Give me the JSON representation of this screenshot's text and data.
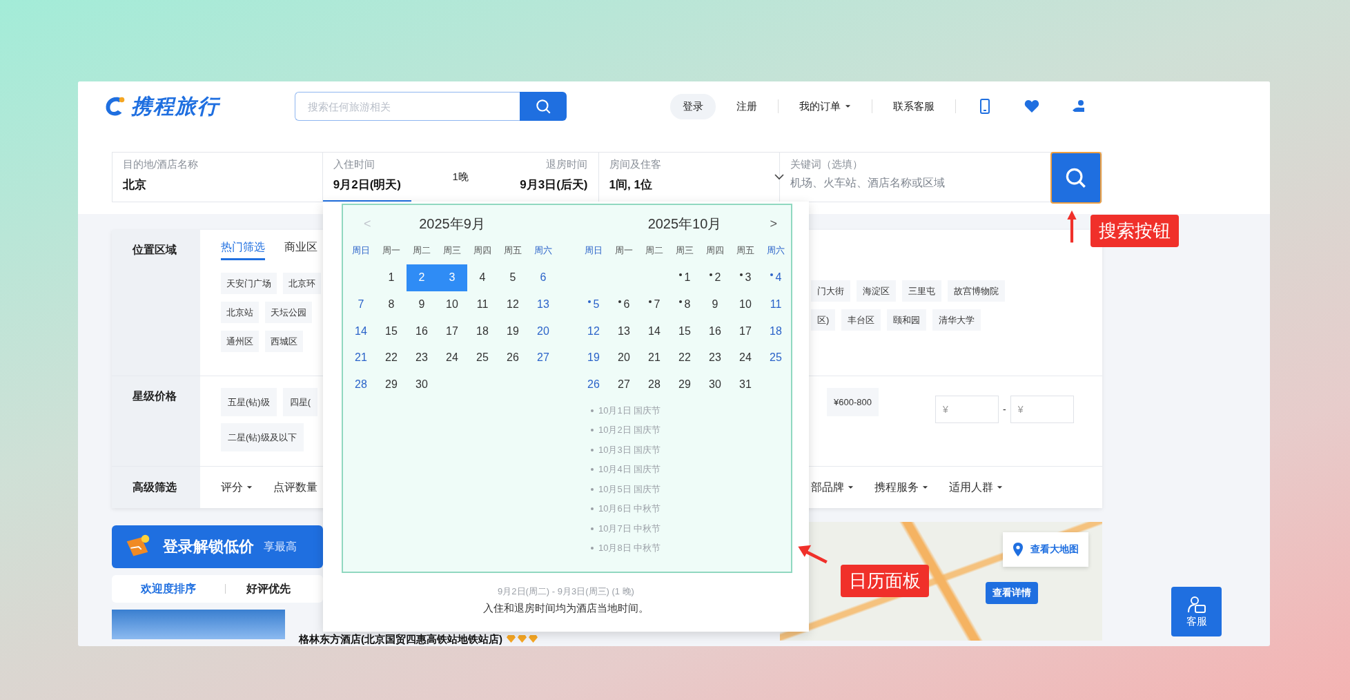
{
  "header": {
    "logo": "携程旅行",
    "search": {
      "placeholder": "搜索任何旅游相关"
    },
    "nav": [
      {
        "label": "登录",
        "kind": "pill"
      },
      {
        "label": "注册",
        "kind": "link"
      },
      {
        "label": "我的订单",
        "kind": "dropdown"
      },
      {
        "label": "联系客服",
        "kind": "link"
      }
    ]
  },
  "search_form": {
    "destination": {
      "label": "目的地/酒店名称",
      "value": "北京"
    },
    "checkin": {
      "label": "入住时间",
      "value": "9月2日(明天)",
      "selected": true
    },
    "nights": "1晚",
    "checkout": {
      "label": "退房时间",
      "value": "9月3日(后天)",
      "selected": false
    },
    "rooms": {
      "label": "房间及住客",
      "value": "1间, 1位"
    },
    "keyword": {
      "label": "关键词（选填）",
      "placeholder": "机场、火车站、酒店名称或区域"
    }
  },
  "filters": {
    "location": {
      "label": "位置区域",
      "tabs": [
        {
          "label": "热门筛选",
          "selected": true
        },
        {
          "label": "商业区",
          "selected": false
        }
      ],
      "tags_left": [
        [
          "天安门广场",
          "北京环"
        ],
        [
          "北京站",
          "天坛公园"
        ],
        [
          "通州区",
          "西城区"
        ]
      ],
      "tags_right": [
        [
          "门大街",
          "海淀区",
          "三里屯",
          "故宫博物院"
        ],
        [
          "区)",
          "丰台区",
          "颐和园",
          "清华大学"
        ]
      ]
    },
    "stars": {
      "label": "星级价格",
      "tags_left": [
        [
          "五星(钻)级",
          "四星("
        ],
        [
          "二星(钻)级及以下"
        ]
      ],
      "tags_right": [
        "¥600-800"
      ],
      "price_min": {
        "placeholder": "¥"
      },
      "range_separator": "-",
      "price_max": {
        "placeholder": "¥"
      }
    },
    "advanced": {
      "label": "高级筛选",
      "left": [
        {
          "label": "评分",
          "caret": true
        },
        {
          "label": "点评数量",
          "caret": false
        }
      ],
      "right": [
        {
          "label": "部品牌",
          "caret": true
        },
        {
          "label": "携程服务",
          "caret": true
        },
        {
          "label": "适用人群",
          "caret": true
        }
      ]
    }
  },
  "calendar": {
    "prev": {
      "label": "<",
      "disabled": true
    },
    "next": {
      "label": ">",
      "disabled": false
    },
    "months": [
      {
        "title": "2025年9月",
        "starts_midweek": true,
        "weekdays": [
          "周日",
          "周一",
          "周二",
          "周三",
          "周四",
          "周五",
          "周六"
        ],
        "weeks": [
          [
            {
              "d": "1",
              "selected": false,
              "holiday": false
            },
            {
              "d": "2",
              "selected": true,
              "holiday": false
            },
            {
              "d": "3",
              "selected": true,
              "holiday": false
            },
            {
              "d": "4",
              "selected": false,
              "holiday": false
            },
            {
              "d": "5",
              "selected": false,
              "holiday": false
            },
            {
              "d": "6",
              "selected": false,
              "holiday": false
            }
          ],
          [
            {
              "d": "7",
              "selected": false,
              "holiday": false
            },
            {
              "d": "8",
              "selected": false,
              "holiday": false
            },
            {
              "d": "9",
              "selected": false,
              "holiday": false
            },
            {
              "d": "10",
              "selected": false,
              "holiday": false
            },
            {
              "d": "11",
              "selected": false,
              "holiday": false
            },
            {
              "d": "12",
              "selected": false,
              "holiday": false
            },
            {
              "d": "13",
              "selected": false,
              "holiday": false
            }
          ],
          [
            {
              "d": "14",
              "selected": false,
              "holiday": false
            },
            {
              "d": "15",
              "selected": false,
              "holiday": false
            },
            {
              "d": "16",
              "selected": false,
              "holiday": false
            },
            {
              "d": "17",
              "selected": false,
              "holiday": false
            },
            {
              "d": "18",
              "selected": false,
              "holiday": false
            },
            {
              "d": "19",
              "selected": false,
              "holiday": false
            },
            {
              "d": "20",
              "selected": false,
              "holiday": false
            }
          ],
          [
            {
              "d": "21",
              "selected": false,
              "holiday": false
            },
            {
              "d": "22",
              "selected": false,
              "holiday": false
            },
            {
              "d": "23",
              "selected": false,
              "holiday": false
            },
            {
              "d": "24",
              "selected": false,
              "holiday": false
            },
            {
              "d": "25",
              "selected": false,
              "holiday": false
            },
            {
              "d": "26",
              "selected": false,
              "holiday": false
            },
            {
              "d": "27",
              "selected": false,
              "holiday": false
            }
          ],
          [
            {
              "d": "28",
              "selected": false,
              "holiday": false
            },
            {
              "d": "29",
              "selected": false,
              "holiday": false
            },
            {
              "d": "30",
              "selected": false,
              "holiday": false
            }
          ]
        ]
      },
      {
        "title": "2025年10月",
        "starts_midweek": true,
        "weekdays": [
          "周日",
          "周一",
          "周二",
          "周三",
          "周四",
          "周五",
          "周六"
        ],
        "weeks": [
          [
            {
              "d": "1",
              "selected": false,
              "holiday": true
            },
            {
              "d": "2",
              "selected": false,
              "holiday": true
            },
            {
              "d": "3",
              "selected": false,
              "holiday": true
            },
            {
              "d": "4",
              "selected": false,
              "holiday": true
            }
          ],
          [
            {
              "d": "5",
              "selected": false,
              "holiday": true
            },
            {
              "d": "6",
              "selected": false,
              "holiday": true
            },
            {
              "d": "7",
              "selected": false,
              "holiday": true
            },
            {
              "d": "8",
              "selected": false,
              "holiday": true
            },
            {
              "d": "9",
              "selected": false,
              "holiday": false
            },
            {
              "d": "10",
              "selected": false,
              "holiday": false
            },
            {
              "d": "11",
              "selected": false,
              "holiday": false
            }
          ],
          [
            {
              "d": "12",
              "selected": false,
              "holiday": false
            },
            {
              "d": "13",
              "selected": false,
              "holiday": false
            },
            {
              "d": "14",
              "selected": false,
              "holiday": false
            },
            {
              "d": "15",
              "selected": false,
              "holiday": false
            },
            {
              "d": "16",
              "selected": false,
              "holiday": false
            },
            {
              "d": "17",
              "selected": false,
              "holiday": false
            },
            {
              "d": "18",
              "selected": false,
              "holiday": false
            }
          ],
          [
            {
              "d": "19",
              "selected": false,
              "holiday": false
            },
            {
              "d": "20",
              "selected": false,
              "holiday": false
            },
            {
              "d": "21",
              "selected": false,
              "holiday": false
            },
            {
              "d": "22",
              "selected": false,
              "holiday": false
            },
            {
              "d": "23",
              "selected": false,
              "holiday": false
            },
            {
              "d": "24",
              "selected": false,
              "holiday": false
            },
            {
              "d": "25",
              "selected": false,
              "holiday": false
            }
          ],
          [
            {
              "d": "26",
              "selected": false,
              "holiday": false
            },
            {
              "d": "27",
              "selected": false,
              "holiday": false
            },
            {
              "d": "28",
              "selected": false,
              "holiday": false
            },
            {
              "d": "29",
              "selected": false,
              "holiday": false
            },
            {
              "d": "30",
              "selected": false,
              "holiday": false
            },
            {
              "d": "31",
              "selected": false,
              "holiday": false
            }
          ]
        ]
      }
    ],
    "holidays": [
      "10月1日 国庆节",
      "10月2日 国庆节",
      "10月3日 国庆节",
      "10月4日 国庆节",
      "10月5日 国庆节",
      "10月6日 中秋节",
      "10月7日 中秋节",
      "10月8日 中秋节"
    ],
    "summary": "9月2日(周二) - 9月3日(周三) (1 晚)",
    "note": "入住和退房时间均为酒店当地时间。"
  },
  "promo": {
    "title": "登录解锁低价",
    "subtitle": "享最高"
  },
  "sort": [
    {
      "label": "欢迎度排序",
      "selected": true
    },
    {
      "label": "好评优先",
      "selected": false
    }
  ],
  "hotel": {
    "name": "格林东方酒店(北京国贸四惠高铁站地铁站店)",
    "stars": 3
  },
  "map": {
    "big_map_button": "查看大地图",
    "detail_button": "查看详情"
  },
  "side_button": "客服",
  "annotations": [
    {
      "text": "搜索按钮",
      "kind": "search"
    },
    {
      "text": "日历面板",
      "kind": "calendar"
    }
  ]
}
